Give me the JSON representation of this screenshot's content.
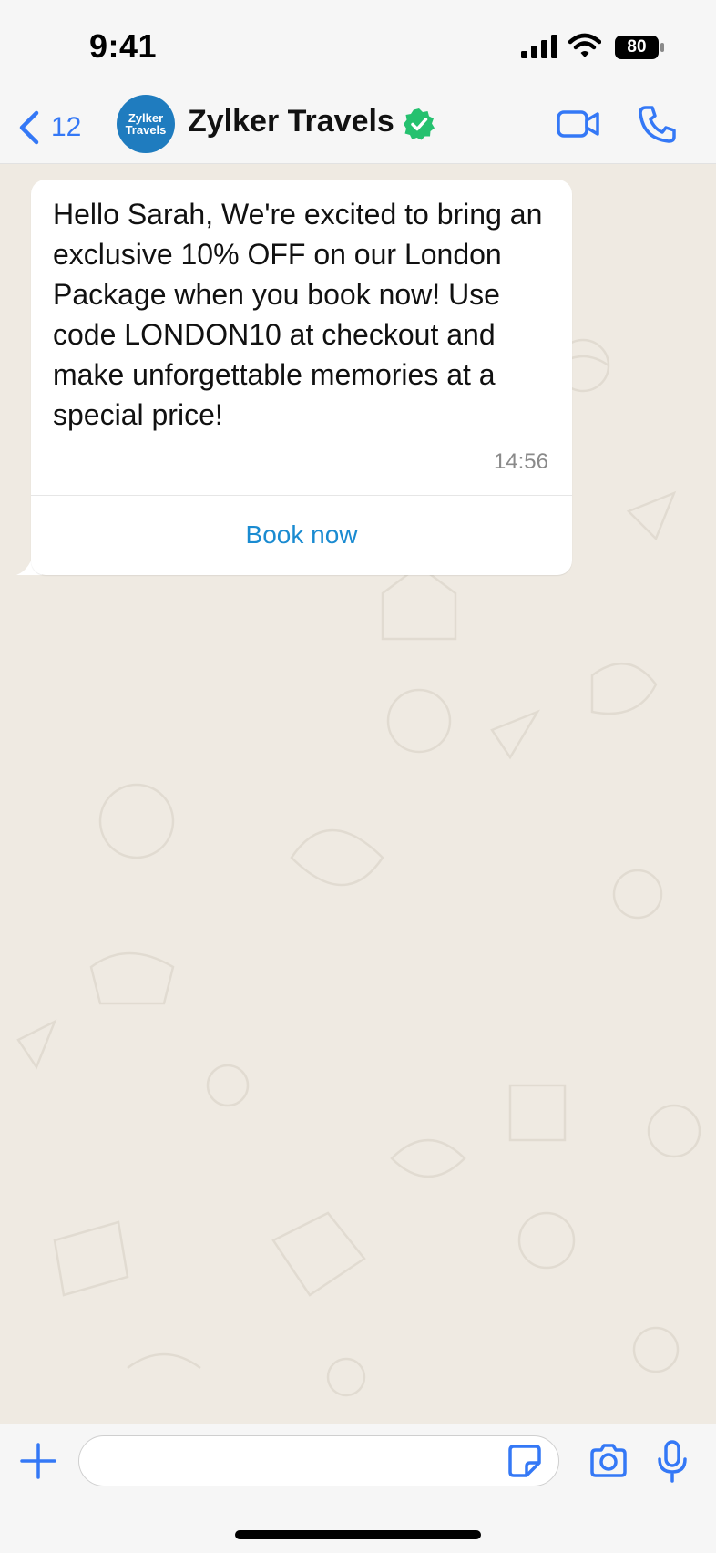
{
  "status": {
    "time": "9:41",
    "battery": "80"
  },
  "header": {
    "back_count": "12",
    "avatar_line1": "Zylker",
    "avatar_line2": "Travels",
    "contact_name": "Zylker Travels"
  },
  "message": {
    "text": "Hello Sarah, We're excited to bring an exclusive 10% OFF on our London Package when you book now! Use code LONDON10 at checkout and make unforgettable memories at a special price!",
    "time": "14:56",
    "cta_label": "Book now"
  },
  "composer": {
    "placeholder": ""
  },
  "colors": {
    "accent": "#3478f6",
    "link": "#1a8bd1",
    "verified": "#25c16f",
    "wallpaper": "#efeae2"
  },
  "icons": {
    "back": "chevron-left-icon",
    "verified": "verified-badge-icon",
    "video": "video-call-icon",
    "phone": "phone-call-icon",
    "plus": "plus-icon",
    "sticker": "sticker-icon",
    "camera": "camera-icon",
    "mic": "microphone-icon"
  }
}
